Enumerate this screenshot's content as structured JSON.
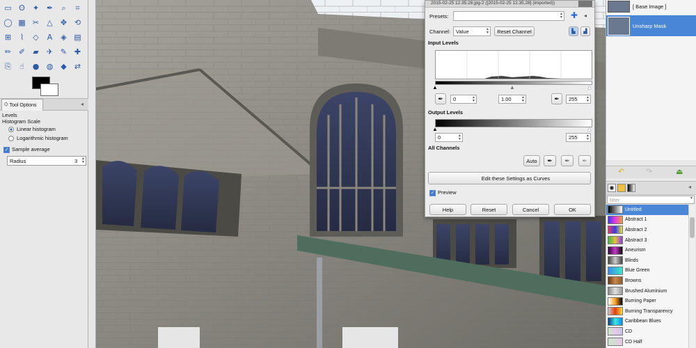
{
  "toolbox": {
    "tools": [
      "rect-select-icon",
      "lasso-icon",
      "fuzzy-select-icon",
      "color-picker-icon",
      "zoom-icon",
      "crop-icon",
      "ellipse-select-icon",
      "by-color-select-icon",
      "scissors-icon",
      "measure-icon",
      "move-icon",
      "rotate-icon",
      "align-icon",
      "path-icon",
      "perspective-icon",
      "text-icon",
      "bucket-fill-icon",
      "gradient-icon",
      "pencil-icon",
      "paintbrush-icon",
      "eraser-icon",
      "airbrush-icon",
      "ink-icon",
      "heal-icon",
      "clone-icon",
      "smudge-icon",
      "dodge-icon",
      "blur-icon",
      "sharpen-icon",
      "flip-icon"
    ],
    "tab_label": "Tool Options",
    "panel_title": "Levels",
    "histogram_scale_label": "Histogram Scale",
    "linear_label": "Linear histogram",
    "log_label": "Logarithmic histogram",
    "sample_label": "Sample average",
    "radius_label": "Radius",
    "radius_value": "3"
  },
  "document": {
    "title": "2015-02-25 12.35.28.jpg-2 ([2015-02-25 12.35.28] (imported))"
  },
  "levels": {
    "presets_label": "Presets:",
    "presets_value": "",
    "channel_label": "Channel:",
    "channel_value": "Value",
    "reset_channel_label": "Reset Channel",
    "input_levels_label": "Input Levels",
    "input_low": "0",
    "input_gamma": "1.00",
    "input_high": "255",
    "output_levels_label": "Output Levels",
    "output_low": "0",
    "output_high": "255",
    "all_channels_label": "All Channels",
    "auto_label": "Auto",
    "curves_label": "Edit these Settings as Curves",
    "preview_label": "Preview",
    "help_label": "Help",
    "reset_label": "Reset",
    "cancel_label": "Cancel",
    "ok_label": "OK"
  },
  "layers": {
    "items": [
      {
        "name": "[ Base Image ]"
      },
      {
        "name": "Unsharp Mask"
      }
    ]
  },
  "gradients": {
    "filter_placeholder": "filter",
    "items": [
      {
        "name": "Untitled",
        "colors": [
          "#000000",
          "#ffffff"
        ]
      },
      {
        "name": "Abstract 1",
        "colors": [
          "#3a3ae8",
          "#e83ae0",
          "#e8a03a"
        ]
      },
      {
        "name": "Abstract 2",
        "colors": [
          "#e83a6a",
          "#3a3ae8",
          "#e8e83a"
        ]
      },
      {
        "name": "Abstract 3",
        "colors": [
          "#3ab84a",
          "#e8c03a",
          "#8a3ae8"
        ]
      },
      {
        "name": "Aneurism",
        "colors": [
          "#2a0a3a",
          "#c83ac8",
          "#0a0a0a"
        ]
      },
      {
        "name": "Blinds",
        "colors": [
          "#444444",
          "#cccccc",
          "#444444"
        ]
      },
      {
        "name": "Blue Green",
        "colors": [
          "#3a8ae8",
          "#3ae8c8"
        ]
      },
      {
        "name": "Browns",
        "colors": [
          "#6a3a1a",
          "#c88a4a",
          "#8a5a2a"
        ]
      },
      {
        "name": "Brushed Aluminium",
        "colors": [
          "#8a8a8a",
          "#e0e0e0",
          "#9a9a9a"
        ]
      },
      {
        "name": "Burning Paper",
        "colors": [
          "#ffffff",
          "#ffa020",
          "#000000"
        ]
      },
      {
        "name": "Burning Transparency",
        "colors": [
          "#cccccc",
          "#e83a0a",
          "#ffe03a"
        ]
      },
      {
        "name": "Caribbean Blues",
        "colors": [
          "#0a3a8a",
          "#3ae8e8",
          "#0a8ae8"
        ]
      },
      {
        "name": "CD",
        "colors": [
          "#c8e8c8",
          "#e8c8e8",
          "#c8c8e8"
        ]
      },
      {
        "name": "CD Half",
        "colors": [
          "#c8e8c8",
          "#e8c8e8"
        ]
      }
    ]
  }
}
